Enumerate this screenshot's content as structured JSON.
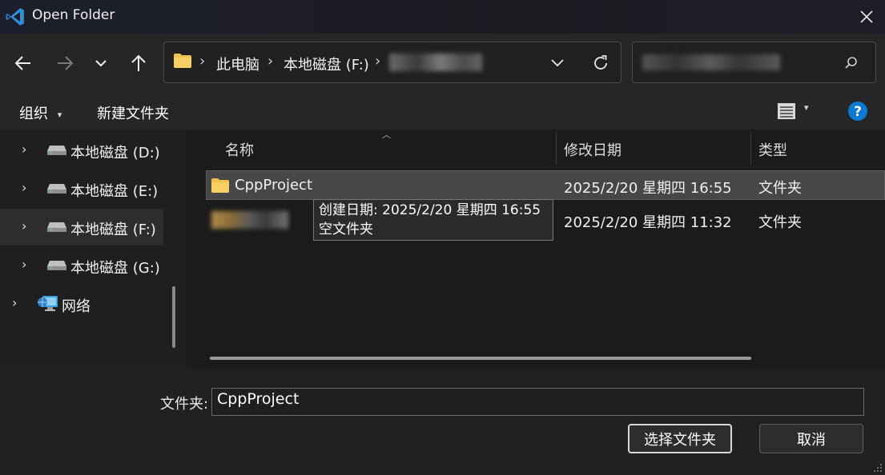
{
  "window": {
    "title": "Open Folder"
  },
  "nav": {
    "breadcrumbs": [
      "此电脑",
      "本地磁盘 (F:)"
    ],
    "path_tail_hidden": "",
    "search": {
      "placeholder": ""
    }
  },
  "command_bar": {
    "organize": "组织",
    "new_folder": "新建文件夹"
  },
  "nav_pane": {
    "items": [
      {
        "label": "本地磁盘 (D:)",
        "icon": "drive-icon",
        "selected": false
      },
      {
        "label": "本地磁盘 (E:)",
        "icon": "drive-icon",
        "selected": false
      },
      {
        "label": "本地磁盘 (F:)",
        "icon": "drive-icon",
        "selected": true
      },
      {
        "label": "本地磁盘 (G:)",
        "icon": "drive-icon",
        "selected": false
      },
      {
        "label": "网络",
        "icon": "network-icon",
        "selected": false
      }
    ]
  },
  "file_list": {
    "columns": [
      "名称",
      "修改日期",
      "类型"
    ],
    "rows": [
      {
        "name": "CppProject",
        "modified": "2025/2/20 星期四 16:55",
        "type": "文件夹",
        "selected": true
      },
      {
        "name": "",
        "modified": "2025/2/20 星期四 11:32",
        "type": "文件夹",
        "selected": false
      }
    ]
  },
  "tooltip": {
    "line1": "创建日期: 2025/2/20 星期四 16:55",
    "line2": "空文件夹"
  },
  "bottom": {
    "folder_label": "文件夹:",
    "folder_value": "CppProject",
    "ok_label": "选择文件夹",
    "cancel_label": "取消"
  },
  "colors": {
    "accent": "#0a7ad6",
    "folder": "#f2c14e",
    "vscode": "#2f8fdb"
  }
}
